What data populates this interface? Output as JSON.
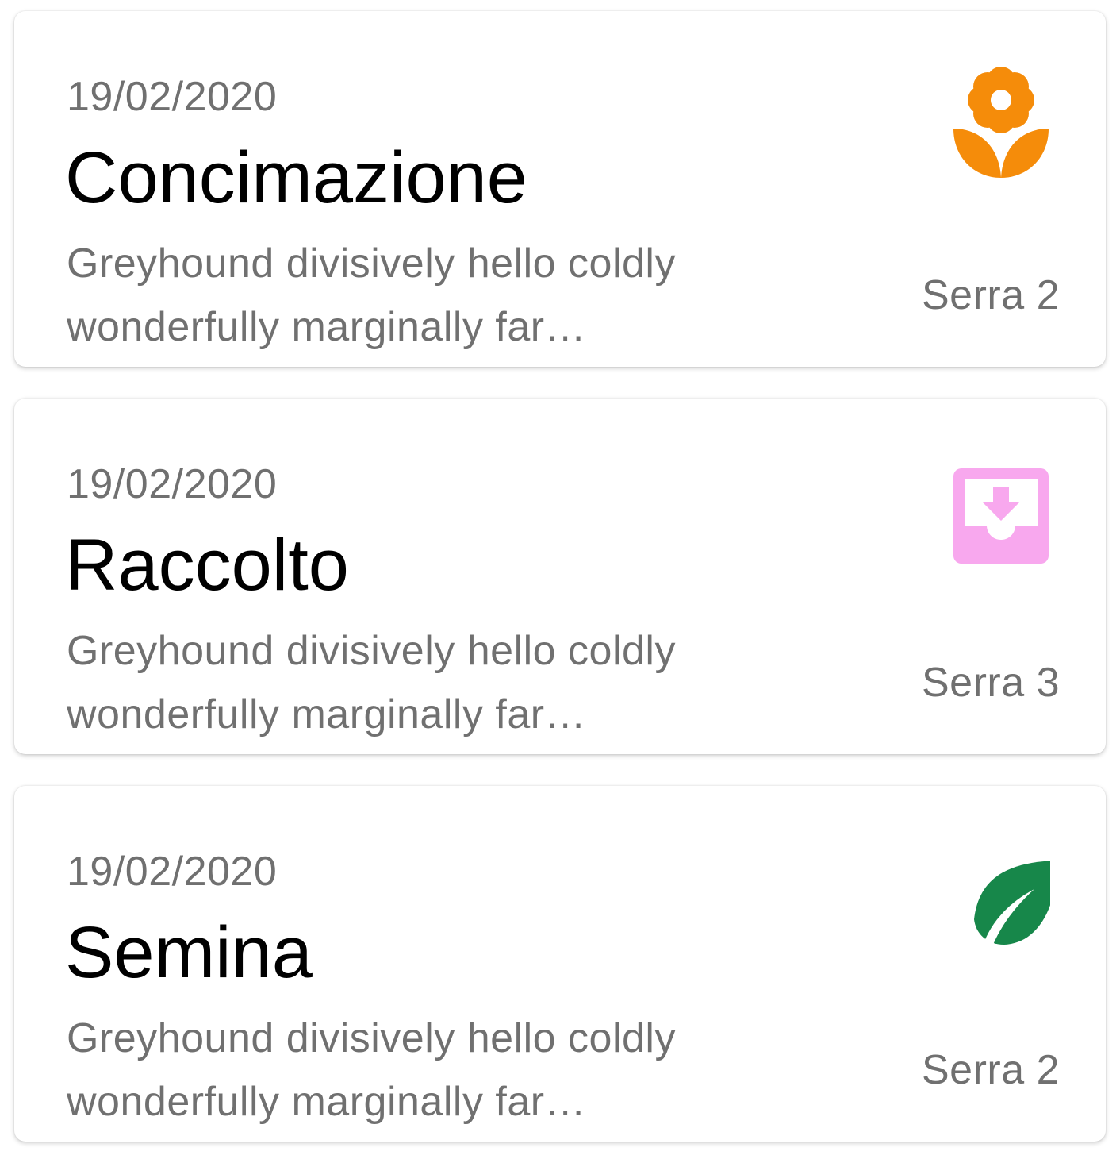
{
  "cards": [
    {
      "date": "19/02/2020",
      "title": "Concimazione",
      "description_line1": "Greyhound divisively hello coldly",
      "description_line2": "wonderfully marginally far…",
      "location": "Serra 2",
      "icon": "flower-icon",
      "icon_color": "#F58C0A"
    },
    {
      "date": "19/02/2020",
      "title": "Raccolto",
      "description_line1": "Greyhound divisively hello coldly",
      "description_line2": "wonderfully marginally far…",
      "location": "Serra 3",
      "icon": "harvest-inbox-icon",
      "icon_color": "#F8A8EE"
    },
    {
      "date": "19/02/2020",
      "title": "Semina",
      "description_line1": "Greyhound divisively hello coldly",
      "description_line2": "wonderfully marginally far…",
      "location": "Serra 2",
      "icon": "leaf-icon",
      "icon_color": "#17874A"
    }
  ]
}
